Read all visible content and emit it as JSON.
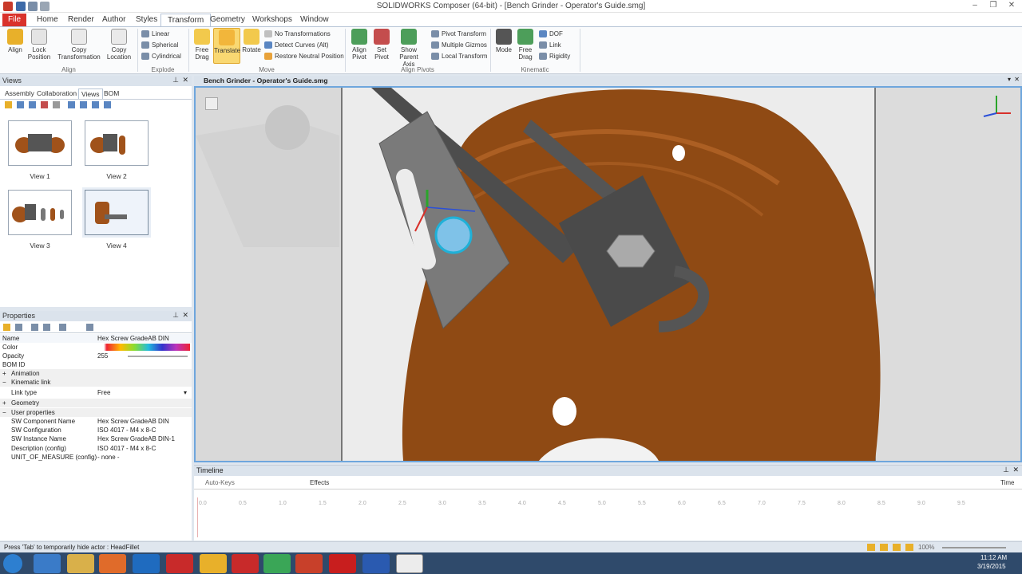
{
  "window": {
    "title": "SOLIDWORKS Composer (64-bit) - [Bench Grinder - Operator's Guide.smg]"
  },
  "menu_tabs": [
    {
      "label": "File"
    },
    {
      "label": "Home"
    },
    {
      "label": "Render"
    },
    {
      "label": "Author"
    },
    {
      "label": "Styles"
    },
    {
      "label": "Transform"
    },
    {
      "label": "Geometry"
    },
    {
      "label": "Workshops"
    },
    {
      "label": "Window"
    }
  ],
  "ribbon": {
    "align_group": {
      "label": "Align",
      "buttons": [
        "Align",
        "Lock Position",
        "Copy Transformation",
        "Copy Location"
      ]
    },
    "explode_group": {
      "label": "Explode",
      "items": [
        "Linear",
        "Spherical",
        "Cylindrical"
      ]
    },
    "move_group": {
      "label": "Move",
      "buttons": [
        "Free Drag",
        "Translate",
        "Rotate"
      ],
      "items": [
        "No Transformations",
        "Detect Curves (Alt)",
        "Restore Neutral Position"
      ]
    },
    "pivots_group": {
      "label": "Align Pivots",
      "buttons": [
        "Align Pivot",
        "Set Pivot",
        "Show Parent Axis"
      ],
      "items": [
        "Pivot Transform",
        "Multiple Gizmos",
        "Local Transform"
      ]
    },
    "kinematic_group": {
      "label": "Kinematic",
      "buttons": [
        "Mode",
        "Free Drag"
      ],
      "items": [
        "DOF",
        "Link",
        "Rigidity"
      ]
    }
  },
  "views_panel": {
    "title": "Views",
    "tabs": [
      "Assembly",
      "Collaboration",
      "Views",
      "BOM"
    ],
    "thumbs": [
      {
        "label": "View 1"
      },
      {
        "label": "View 2"
      },
      {
        "label": "View 3"
      },
      {
        "label": "View 4"
      }
    ]
  },
  "properties_panel": {
    "title": "Properties",
    "rows": [
      {
        "key": "Name",
        "value": "Hex Screw GradeAB DIN"
      },
      {
        "key": "Color",
        "value": ""
      },
      {
        "key": "Opacity",
        "value": "255"
      },
      {
        "key": "BOM ID",
        "value": ""
      },
      {
        "key": "Animation",
        "value": ""
      },
      {
        "key": "Kinematic link",
        "value": ""
      },
      {
        "key": "Link type",
        "value": "Free"
      },
      {
        "key": "Geometry",
        "value": ""
      },
      {
        "key": "User properties",
        "value": ""
      },
      {
        "key": "SW Component Name",
        "value": "Hex Screw GradeAB DIN"
      },
      {
        "key": "SW Configuration",
        "value": "ISO 4017 - M4 x 8-C"
      },
      {
        "key": "SW Instance Name",
        "value": "Hex Screw GradeAB DIN-1"
      },
      {
        "key": "Description (config)",
        "value": "ISO 4017 - M4 x 8-C"
      },
      {
        "key": "UNIT_OF_MEASURE (config)",
        "value": "- none -"
      }
    ]
  },
  "document": {
    "tab": "Bench Grinder - Operator's Guide.smg"
  },
  "timeline": {
    "title": "Timeline",
    "auto_keys": "Auto-Keys",
    "effects": "Effects",
    "time_label": "Time",
    "ticks": [
      "0.0",
      "0.5",
      "1.0",
      "1.5",
      "2.0",
      "2.5",
      "3.0",
      "3.5",
      "4.0",
      "4.5",
      "5.0",
      "5.5",
      "6.0",
      "6.5",
      "7.0",
      "7.5",
      "8.0",
      "8.5",
      "9.0",
      "9.5"
    ]
  },
  "status": {
    "text": "Press 'Tab' to temporarily hide actor : HeadFillet",
    "zoom": "100%"
  },
  "taskbar": {
    "time": "11:12 AM",
    "date": "3/19/2015"
  },
  "colors": {
    "accent": "#6ea6dd",
    "copper": "#8f4a14",
    "file_tab": "#d9322b"
  }
}
